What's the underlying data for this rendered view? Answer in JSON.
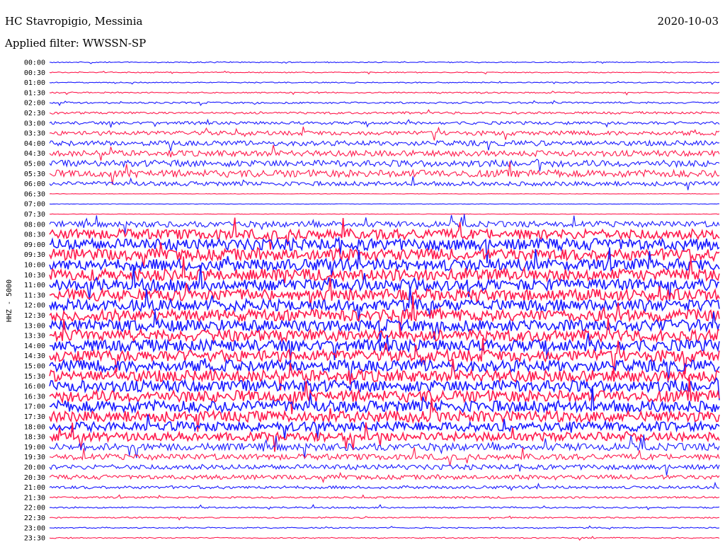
{
  "header": {
    "station": "HC Stavropigio, Messinia",
    "date": "2020-10-03",
    "filter": "Applied filter: WWSSN-SP"
  },
  "chart_data": {
    "type": "helicorder",
    "ylabel": "HHZ - 5000",
    "colors": [
      "#1a1aff",
      "#ff1a4d"
    ],
    "rows": [
      "00:00",
      "00:30",
      "01:00",
      "01:30",
      "02:00",
      "02:30",
      "03:00",
      "03:30",
      "04:00",
      "04:30",
      "05:00",
      "05:30",
      "06:00",
      "06:30",
      "07:00",
      "07:30",
      "08:00",
      "08:30",
      "09:00",
      "09:30",
      "10:00",
      "10:30",
      "11:00",
      "11:30",
      "12:00",
      "12:30",
      "13:00",
      "13:30",
      "14:00",
      "14:30",
      "15:00",
      "15:30",
      "16:00",
      "16:30",
      "17:00",
      "17:30",
      "18:00",
      "18:30",
      "19:00",
      "19:30",
      "20:00",
      "20:30",
      "21:00",
      "21:30",
      "22:00",
      "22:30",
      "23:00",
      "23:30"
    ],
    "noise_level": [
      0.6,
      0.6,
      0.7,
      0.8,
      1.2,
      1.5,
      2.0,
      3.0,
      3.5,
      4.0,
      4.5,
      5.0,
      3.0,
      0.0,
      0.0,
      0.0,
      4.0,
      7.0,
      8.0,
      8.0,
      8.0,
      8.0,
      8.0,
      8.0,
      8.0,
      8.0,
      8.0,
      8.0,
      8.0,
      8.0,
      8.0,
      8.0,
      8.0,
      8.0,
      8.0,
      7.5,
      6.5,
      6.0,
      5.0,
      4.0,
      3.5,
      3.0,
      2.0,
      1.2,
      1.0,
      0.8,
      0.7,
      0.7
    ]
  }
}
